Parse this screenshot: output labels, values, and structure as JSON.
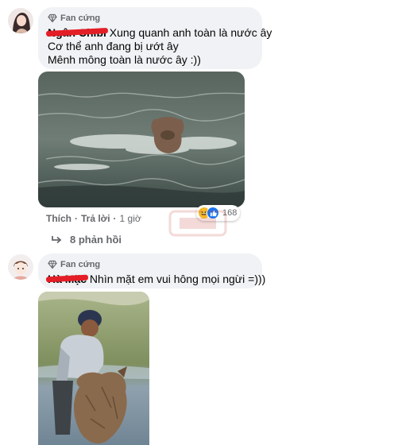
{
  "comments": [
    {
      "badge": "Fan cứng",
      "author": "Ngân Chibi",
      "text": "Xung quanh anh toàn là nước ây",
      "line2": "Cơ thể anh đang bị ướt ây",
      "line3": "Mênh mông toàn là nước ây :))",
      "actions": {
        "like": "Thích",
        "reply": "Trả lời",
        "time": "1 giờ"
      },
      "reaction_count": "168",
      "replies_label": "8 phản hồi"
    },
    {
      "badge": "Fan cứng",
      "author": "Hà Mặc",
      "text": "Nhìn mặt em vui hông mọi ngừi =)))"
    }
  ],
  "colors": {
    "bubble": "#f0f2f5",
    "meta": "#65676b",
    "like_blue": "#1877f2",
    "haha_yellow": "#f7b928",
    "redact": "#e41e26"
  }
}
